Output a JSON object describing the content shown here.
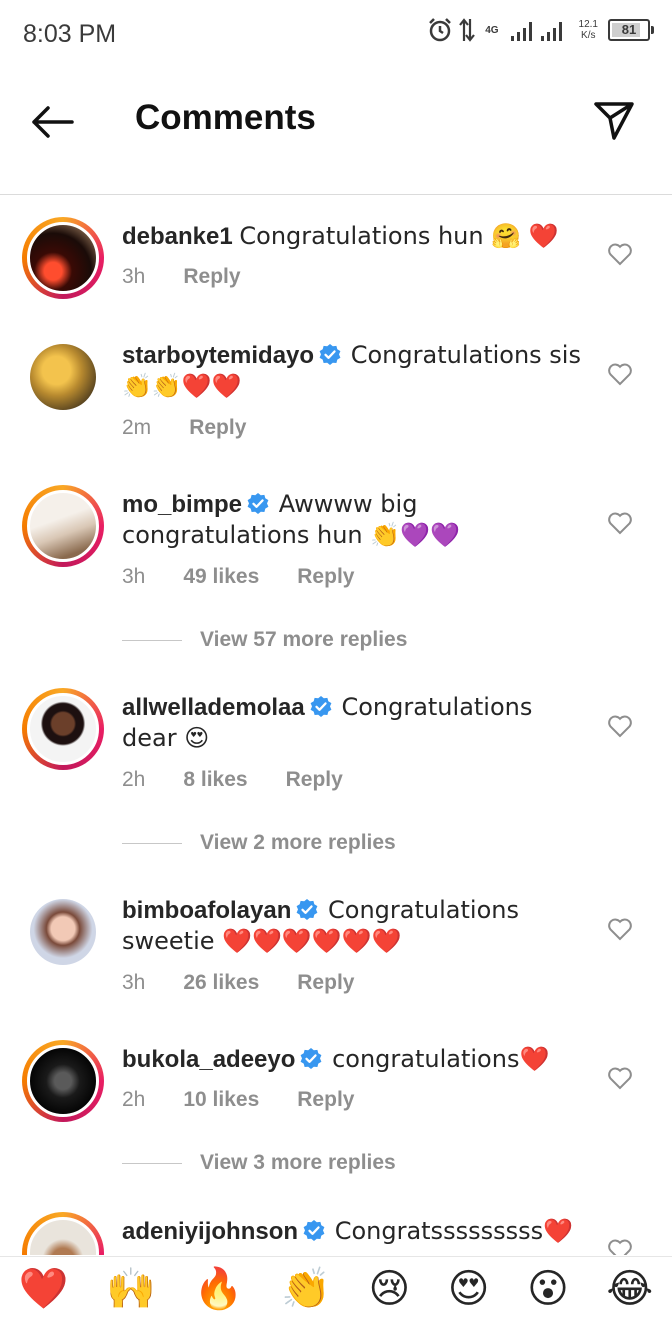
{
  "status": {
    "time": "8:03 PM",
    "net_type": "4G",
    "speed_value": "12.1",
    "speed_unit": "K/s",
    "battery": "81",
    "battery_level": 0.81
  },
  "header": {
    "title": "Comments"
  },
  "comments": [
    {
      "user": "debanke1",
      "verified": false,
      "text": "Congratulations hun 🤗 ❤️",
      "time": "3h",
      "likes": "",
      "reply": "Reply",
      "view_replies": ""
    },
    {
      "user": "starboytemidayo",
      "verified": true,
      "text": "Congratulations sis 👏👏❤️❤️",
      "time": "2m",
      "likes": "",
      "reply": "Reply",
      "view_replies": ""
    },
    {
      "user": "mo_bimpe",
      "verified": true,
      "text": "Awwww big congratulations hun 👏💜💜",
      "time": "3h",
      "likes": "49 likes",
      "reply": "Reply",
      "view_replies": "View 57 more replies"
    },
    {
      "user": "allwellademolaa",
      "verified": true,
      "text": "Congratulations dear 😍",
      "time": "2h",
      "likes": "8 likes",
      "reply": "Reply",
      "view_replies": "View 2 more replies"
    },
    {
      "user": "bimboafolayan",
      "verified": true,
      "text": "Congratulations sweetie ❤️❤️❤️❤️❤️❤️",
      "time": "3h",
      "likes": "26 likes",
      "reply": "Reply",
      "view_replies": ""
    },
    {
      "user": "bukola_adeeyo",
      "verified": true,
      "text": "congratulations❤️",
      "time": "2h",
      "likes": "10 likes",
      "reply": "Reply",
      "view_replies": "View 3 more replies"
    },
    {
      "user": "adeniyijohnson",
      "verified": true,
      "text": "Congratsssssssss❤️",
      "time": "",
      "likes": "",
      "reply": "",
      "view_replies": ""
    }
  ],
  "emoji_bar": [
    "❤️",
    "🙌",
    "🔥",
    "👏",
    "😢",
    "😍",
    "😮",
    "😂"
  ],
  "icons": {
    "back": "back-arrow-icon",
    "send": "paper-plane-icon",
    "like": "heart-outline-icon",
    "verified": "verified-badge-icon"
  },
  "colors": {
    "verified": "#3897f0",
    "meta": "#8e8e8e",
    "text": "#262626",
    "story_ring": "#e91e63"
  }
}
